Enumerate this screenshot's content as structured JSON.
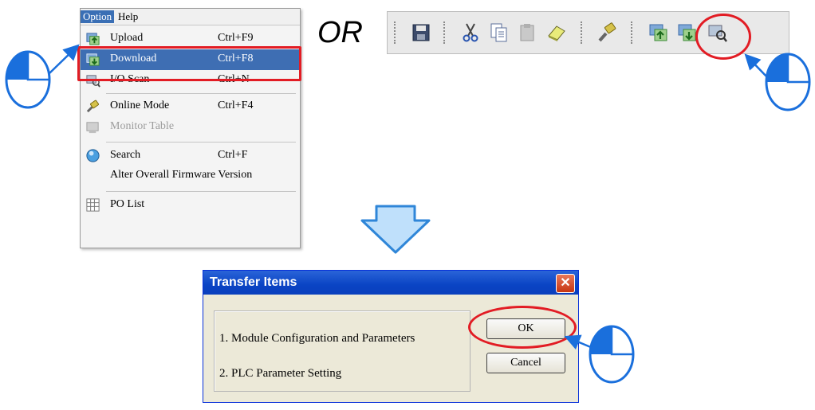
{
  "menu": {
    "bar": {
      "option": "Option",
      "help": "Help"
    },
    "items": [
      {
        "label": "Upload",
        "shortcut": "Ctrl+F9",
        "icon": "upload-icon"
      },
      {
        "label": "Download",
        "shortcut": "Ctrl+F8",
        "icon": "download-icon"
      },
      {
        "label": "I/O Scan",
        "shortcut": "Ctrl+N",
        "icon": "io-scan-icon"
      },
      {
        "label": "Online Mode",
        "shortcut": "Ctrl+F4",
        "icon": "online-mode-icon"
      },
      {
        "label": "Monitor Table",
        "shortcut": "",
        "icon": "monitor-table-icon"
      },
      {
        "label": "Search",
        "shortcut": "Ctrl+F",
        "icon": "search-icon"
      },
      {
        "label": "Alter Overall Firmware Version",
        "shortcut": "",
        "icon": ""
      },
      {
        "label": "PO List",
        "shortcut": "",
        "icon": "po-list-icon"
      }
    ]
  },
  "or_text": "OR",
  "toolbar": {
    "buttons": [
      "save-icon",
      "cut-icon",
      "copy-icon",
      "paste-icon",
      "eraser-icon",
      "online-mode-icon",
      "upload-icon",
      "download-icon",
      "io-scan-icon"
    ]
  },
  "dialog": {
    "title": "Transfer Items",
    "items": [
      "1. Module Configuration and Parameters",
      "2. PLC Parameter Setting"
    ],
    "ok_label": "OK",
    "cancel_label": "Cancel"
  },
  "colors": {
    "highlight_red": "#e21c24",
    "pointer_blue": "#1a6fdc",
    "menu_selection": "#3e6eb3",
    "title_bar": "#0a44c4"
  }
}
